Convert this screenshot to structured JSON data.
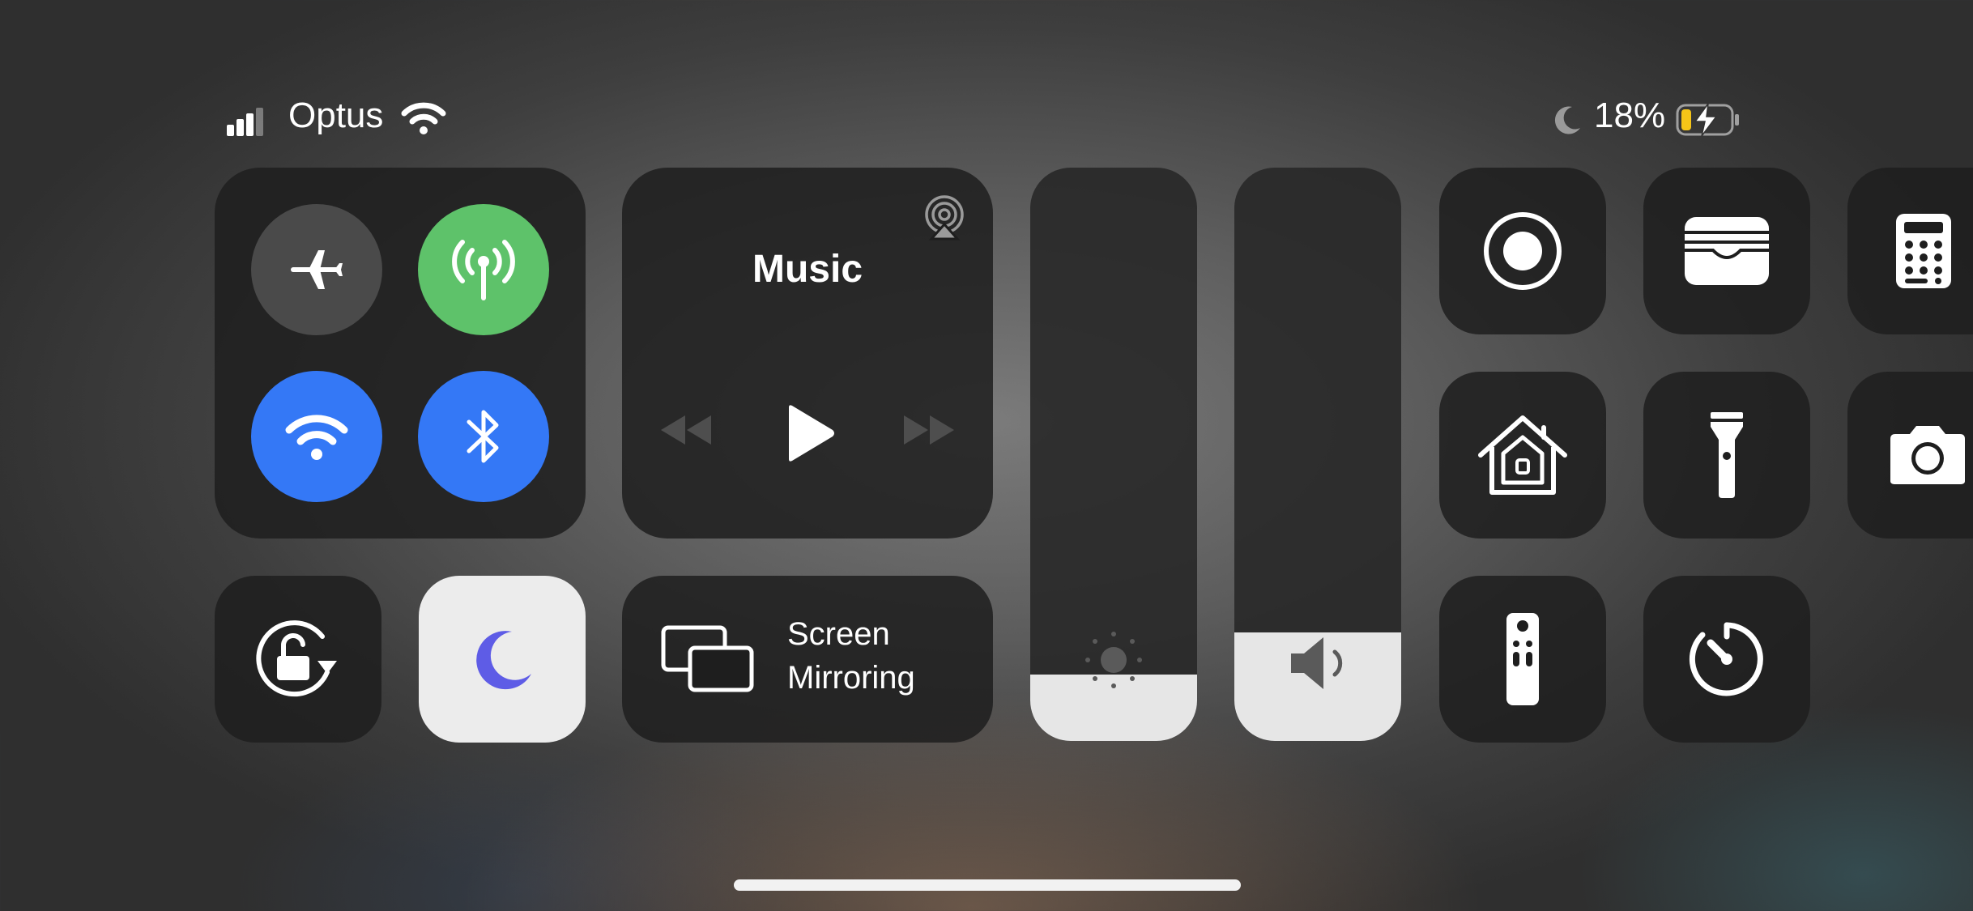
{
  "status_bar": {
    "carrier": "Optus",
    "battery_percent": "18%",
    "signal_bars_active": 3,
    "signal_bars_total": 4,
    "focus_icon": "moon-icon",
    "battery_state": "charging"
  },
  "connectivity": {
    "airplane_mode": {
      "icon": "airplane-icon",
      "on": false
    },
    "cellular_data": {
      "icon": "cellular-antenna-icon",
      "on": true,
      "color": "#5ec26a"
    },
    "wifi": {
      "icon": "wifi-icon",
      "on": true,
      "color": "#3478f6"
    },
    "bluetooth": {
      "icon": "bluetooth-icon",
      "on": true,
      "color": "#3478f6"
    }
  },
  "music": {
    "title": "Music",
    "airplay_icon": "airplay-icon",
    "controls": [
      "rewind-icon",
      "play-icon",
      "fast-forward-icon"
    ]
  },
  "screen_mirroring": {
    "line1": "Screen",
    "line2": "Mirroring",
    "icon": "screen-mirroring-icon"
  },
  "orientation_lock": {
    "icon": "rotation-lock-icon",
    "on": false
  },
  "focus_tile": {
    "icon": "moon-icon",
    "on": true,
    "accent": "#5e5ce6"
  },
  "brightness": {
    "icon": "sun-icon",
    "level": 0.08
  },
  "volume": {
    "icon": "speaker-icon",
    "level": 0.13
  },
  "shortcuts": [
    {
      "name": "screen-recording",
      "icon": "record-icon"
    },
    {
      "name": "wallet",
      "icon": "wallet-icon"
    },
    {
      "name": "calculator",
      "icon": "calculator-icon"
    },
    {
      "name": "home",
      "icon": "home-icon"
    },
    {
      "name": "flashlight",
      "icon": "flashlight-icon"
    },
    {
      "name": "camera",
      "icon": "camera-icon"
    },
    {
      "name": "apple-tv-remote",
      "icon": "remote-icon"
    },
    {
      "name": "timer",
      "icon": "timer-icon"
    }
  ],
  "colors": {
    "green": "#5ec26a",
    "blue": "#3478f6",
    "battery_low": "#f5c518",
    "purple": "#5e5ce6"
  }
}
